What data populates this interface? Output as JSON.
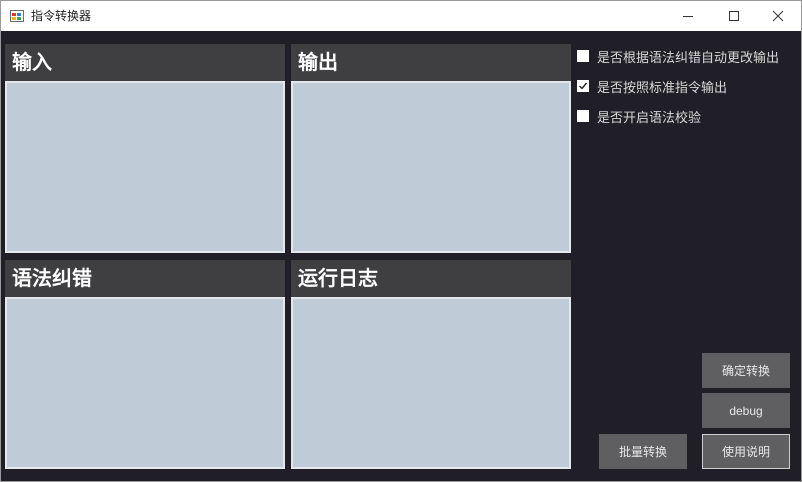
{
  "window": {
    "title": "指令转换器",
    "icons": {
      "app": "app-window-icon",
      "minimize": "minimize-icon",
      "maximize": "maximize-icon",
      "close": "close-icon"
    }
  },
  "panels": {
    "input": {
      "title": "输入"
    },
    "output": {
      "title": "输出"
    },
    "grammar": {
      "title": "语法纠错"
    },
    "log": {
      "title": "运行日志"
    }
  },
  "options": [
    {
      "label": "是否根据语法纠错自动更改输出",
      "checked": false
    },
    {
      "label": "是否按照标准指令输出",
      "checked": true
    },
    {
      "label": "是否开启语法校验",
      "checked": false
    }
  ],
  "buttons": {
    "confirm": "确定转换",
    "debug": "debug",
    "batch": "批量转换",
    "help": "使用说明"
  },
  "colors": {
    "background": "#201f27",
    "panel_header": "#3f3f41",
    "textbox": "#bfcbd7",
    "button": "#5f5f61"
  }
}
